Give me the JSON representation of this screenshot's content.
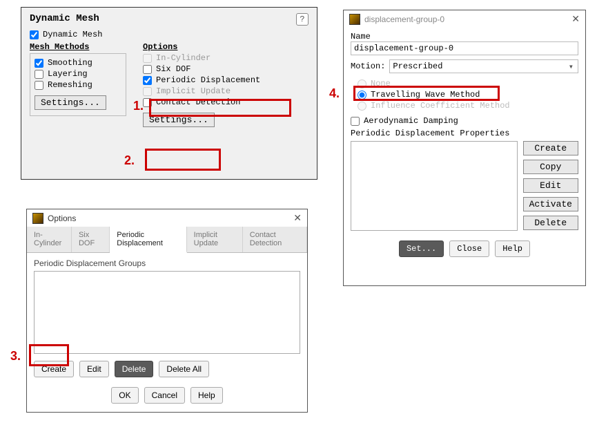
{
  "panel1": {
    "title": "Dynamic Mesh",
    "checkbox_main": "Dynamic Mesh",
    "methods_header": "Mesh Methods",
    "options_header": "Options",
    "methods": {
      "smoothing": "Smoothing",
      "layering": "Layering",
      "remeshing": "Remeshing"
    },
    "options": {
      "in_cylinder": "In-Cylinder",
      "six_dof": "Six DOF",
      "periodic_displacement": "Periodic Displacement",
      "implicit_update": "Implicit Update",
      "contact_detection": "Contact Detection"
    },
    "settings_btn_left": "Settings...",
    "settings_btn_right": "Settings..."
  },
  "panel2": {
    "title": "Options",
    "tabs": {
      "in_cylinder": "In-Cylinder",
      "six_dof": "Six DOF",
      "periodic_displacement": "Periodic Displacement",
      "implicit_update": "Implicit Update",
      "contact_detection": "Contact Detection"
    },
    "section_label": "Periodic Displacement Groups",
    "buttons": {
      "create": "Create",
      "edit": "Edit",
      "delete": "Delete",
      "delete_all": "Delete All",
      "ok": "OK",
      "cancel": "Cancel",
      "help": "Help"
    }
  },
  "panel3": {
    "title": "displacement-group-0",
    "name_label": "Name",
    "name_value": "displacement-group-0",
    "motion_label": "Motion:",
    "motion_value": "Prescribed",
    "radios": {
      "none": "None",
      "twm": "Travelling Wave Method",
      "icm": "Influence Coefficient Method"
    },
    "aero_damping": "Aerodynamic Damping",
    "props_label": "Periodic Displacement Properties",
    "side_buttons": {
      "create": "Create",
      "copy": "Copy",
      "edit": "Edit",
      "activate": "Activate",
      "delete": "Delete"
    },
    "bottom": {
      "set": "Set...",
      "close": "Close",
      "help": "Help"
    }
  },
  "annotations": {
    "n1": "1.",
    "n2": "2.",
    "n3": "3.",
    "n4": "4."
  }
}
